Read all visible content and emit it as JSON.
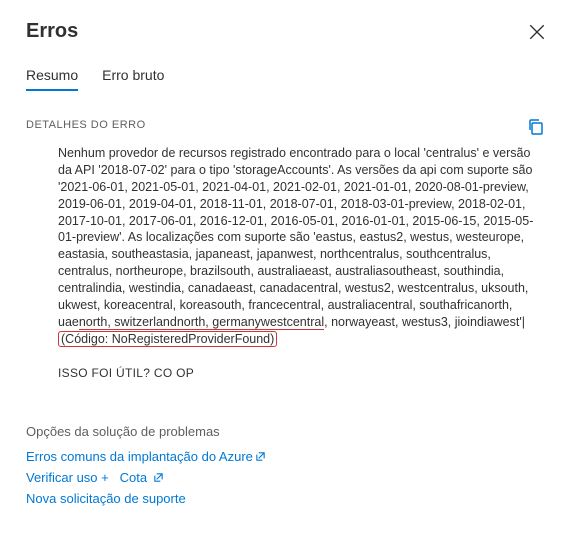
{
  "header": {
    "title": "Erros"
  },
  "tabs": {
    "summary": "Resumo",
    "raw": "Erro bruto"
  },
  "section": {
    "label": "DETALHES DO ERRO",
    "message_pre": "Nenhum provedor de recursos registrado encontrado para o local 'centralus' e versão da API '2018-07-02' para o tipo 'storageAccounts'. As versões da api com suporte são '2021-06-01, 2021-05-01, 2021-04-01, 2021-02-01, 2021-01-01, 2020-08-01-preview, 2019-06-01, 2019-04-01, 2018-11-01, 2018-07-01, 2018-03-01-preview, 2018-02-01, 2017-10-01, 2017-06-01, 2016-12-01, 2016-05-01, 2016-01-01, 2015-06-15, 2015-05-01-preview'. As localizações com suporte são 'eastus, eastus2, westus, westeurope, eastasia, southeastasia, japaneast, japanwest, northcentralus, southcentralus, centralus, northeurope, brazilsouth, australiaeast, australiasoutheast, southindia, centralindia, westindia, canadaeast, canadacentral, westus2, westcentralus, uksouth, ukwest, koreacentral, koreasouth, francecentral, australiacentral, southafricanorth, uae",
    "message_ul1": "north, switzerlandnorth, germanywestcentral",
    "message_mid": ", norwayeast, westus3, jioindiawest'| ",
    "message_ul2": "(Código: NoRegisteredProviderFound)"
  },
  "helpful": {
    "text": "ISSO FOI ÚTIL? CO OP"
  },
  "troubleshoot": {
    "heading": "Opções da solução de problemas",
    "common": "Erros comuns da implantação do Azure",
    "usage": "Verificar uso +",
    "quota": "Cota",
    "support": "Nova solicitação de suporte"
  }
}
